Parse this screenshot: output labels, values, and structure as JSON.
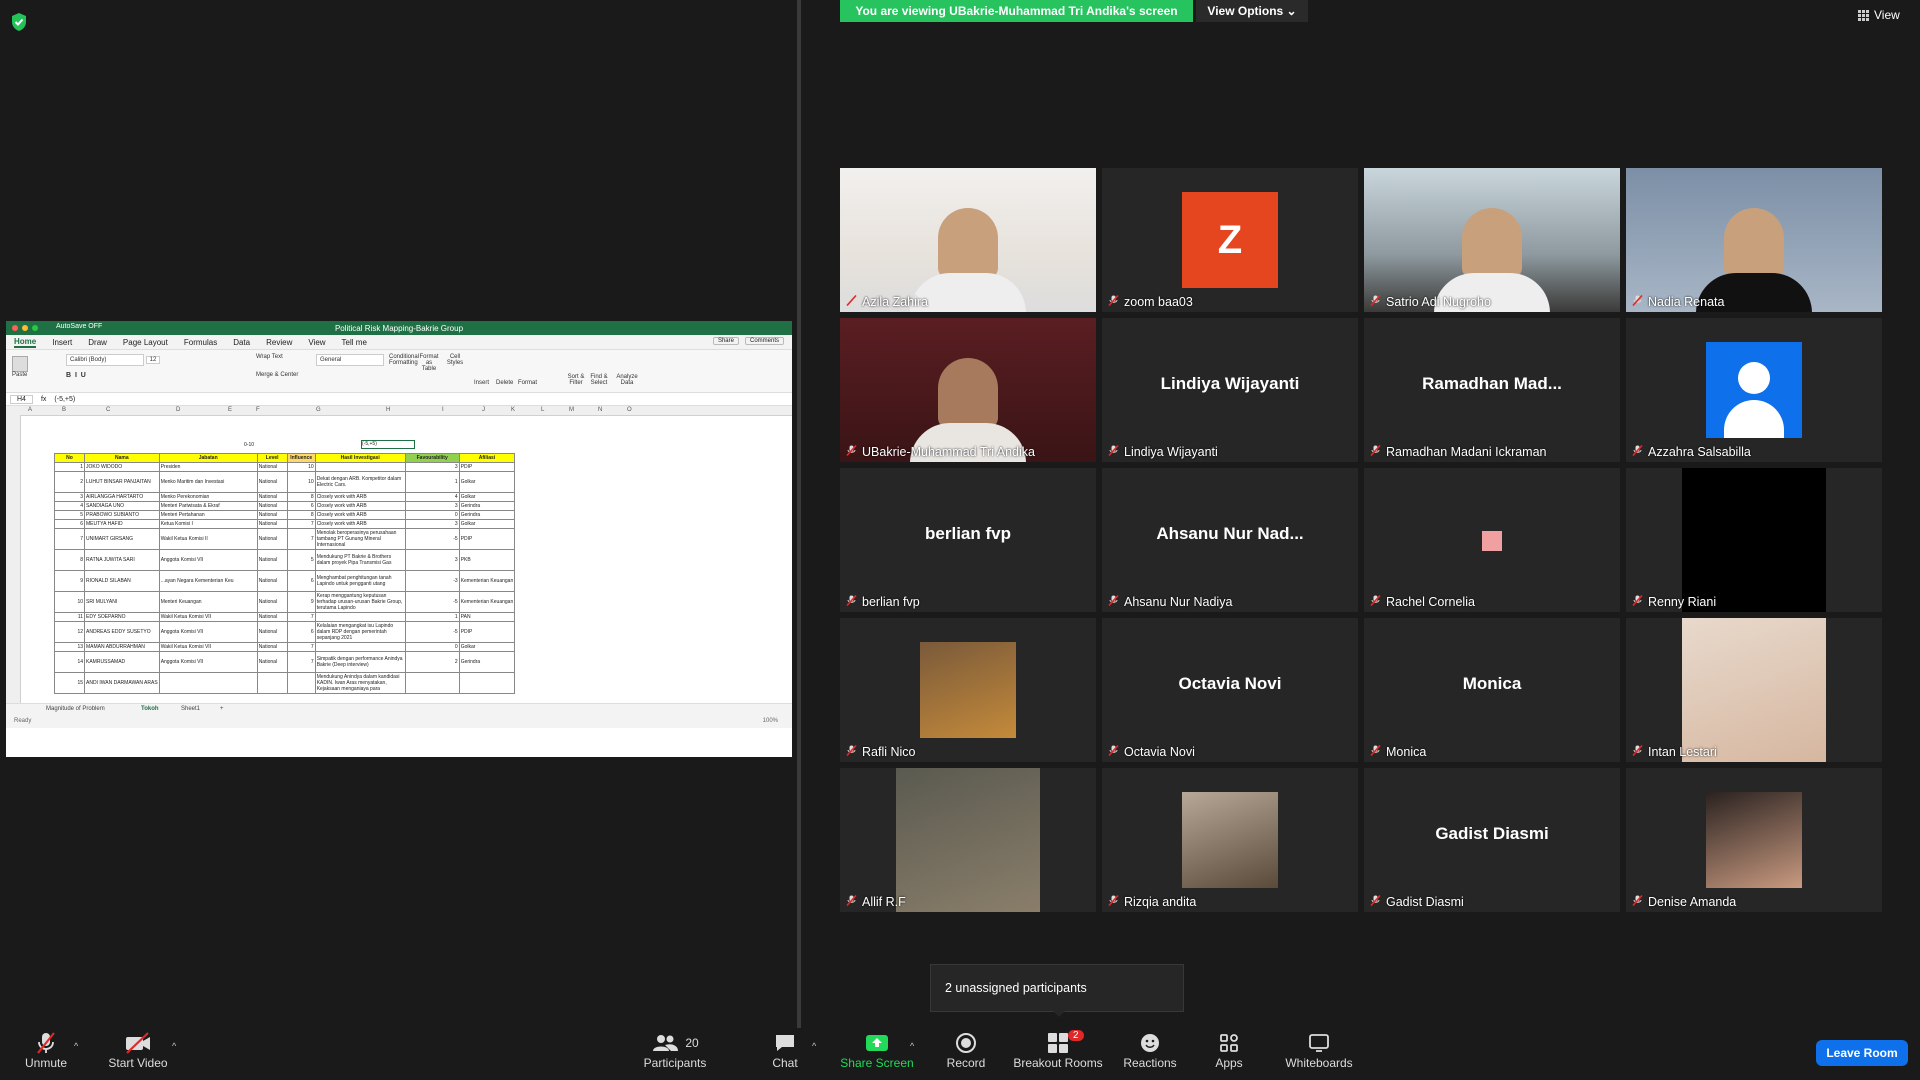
{
  "banner": {
    "text": "You are viewing UBakrie-Muhammad Tri Andika's screen",
    "view_options": "View Options"
  },
  "view_button": "View",
  "excel": {
    "autosave": "AutoSave  OFF",
    "title": "Political Risk Mapping-Bakrie Group",
    "tabs": [
      "Home",
      "Insert",
      "Draw",
      "Page Layout",
      "Formulas",
      "Data",
      "Review",
      "View",
      "Tell me"
    ],
    "share": "Share",
    "comments": "Comments",
    "ribbon": {
      "paste": "Paste",
      "font": "Calibri (Body)",
      "size": "12",
      "wrap": "Wrap Text",
      "merge": "Merge & Center",
      "format": "General",
      "cond": "Conditional Formatting",
      "fmt_table": "Format as Table",
      "cell_styles": "Cell Styles",
      "insert": "Insert",
      "delete": "Delete",
      "format_btn": "Format",
      "sort": "Sort & Filter",
      "find": "Find & Select",
      "analyze": "Analyze Data"
    },
    "cell_ref": "H4",
    "formula": "(-5,+5)",
    "columns": [
      "A",
      "B",
      "C",
      "D",
      "E",
      "F",
      "G",
      "H",
      "I",
      "J",
      "K",
      "L",
      "M",
      "N",
      "O"
    ],
    "scale_f": "0-10",
    "scale_h": "(-5,+5)",
    "headers": [
      "No",
      "Nama",
      "Jabatan",
      "Level",
      "Influence",
      "Hasil Investigasi",
      "Favourability",
      "Afiliasi"
    ],
    "rows": [
      [
        "1",
        "JOKO WIDODO",
        "Presiden",
        "National",
        "10",
        "",
        "3",
        "PDIP"
      ],
      [
        "2",
        "LUHUT BINSAR PANJAITAN",
        "Menko Maritim dan Investasi",
        "National",
        "10",
        "Dekat dengan ARB. Kompetitor dalam Electric Cars.",
        "1",
        "Golkar"
      ],
      [
        "3",
        "AIRLANGGA HARTARTO",
        "Menko Perekonomian",
        "National",
        "8",
        "Closely work with ARB",
        "4",
        "Golkar"
      ],
      [
        "4",
        "SANDIAGA UNO",
        "Menteri Pariwisata & Ekraf",
        "National",
        "6",
        "Closely work with ARB",
        "3",
        "Gerindra"
      ],
      [
        "5",
        "PRABOWO SUBIANTO",
        "Menteri Pertahanan",
        "National",
        "8",
        "Closely work with ARB",
        "0",
        "Gerindra"
      ],
      [
        "6",
        "MEUTYA HAFID",
        "Ketua Komisi I",
        "National",
        "7",
        "Closely work with ARB",
        "3",
        "Golkar"
      ],
      [
        "7",
        "UNIMART GIRSANG",
        "Wakil Ketua Komisi II",
        "National",
        "7",
        "Menolak beroperasinya perusahaan tambang PT Gunung Mineral Internasional",
        "-5",
        "PDIP"
      ],
      [
        "8",
        "RATNA JUWITA SARI",
        "Anggota Komisi VII",
        "National",
        "5",
        "Mendukung PT Bakrie & Brothers dalam proyek Pipa Transmisi Gas",
        "3",
        "PKB"
      ],
      [
        "9",
        "RIONALD SILABAN",
        "...ayan Negara Kementerian Keu",
        "National",
        "6",
        "Menghambat penghitungan tanah Lapindo untuk pengganti utang",
        "-3",
        "Kementerian Keuangan"
      ],
      [
        "10",
        "SRI MULYANI",
        "Menteri Keuangan",
        "National",
        "9",
        "Kerap menggantung keputusan terhadap urusan-urusan Bakrie Group, terutama Lapindo",
        "-5",
        "Kementerian Keuangan"
      ],
      [
        "11",
        "EDY SOEPARNO",
        "Wakil Ketua Komisi VII",
        "National",
        "7",
        "",
        "1",
        "PAN"
      ],
      [
        "12",
        "ANDREAS EDDY SUSETYO",
        "Anggota Komisi VII",
        "National",
        "6",
        "Kelalaian mengangkat isu Lapindo dalam RDP dengan pemerintah sepanjang 2021",
        "-5",
        "PDIP"
      ],
      [
        "13",
        "MAMAN ABDURRAHMAN",
        "Wakil Ketua Komisi VII",
        "National",
        "7",
        "",
        "0",
        "Golkar"
      ],
      [
        "14",
        "KAMRUSSAMAD",
        "Anggota Komisi VII",
        "National",
        "7",
        "Simpatik dengan performance Anindya Bakrie (Deep interview)",
        "2",
        "Gerindra"
      ],
      [
        "15",
        "ANDI IWAN DARMAWAN ARAS",
        "",
        "",
        "",
        "Mendukung Anindya dalam kandidasi KADIN. Iwan Aras menyatakan, Kejaksaan menganiaya para",
        "",
        ""
      ]
    ],
    "sheets": [
      "Magnitude of Problem",
      "Tokoh",
      "Sheet1"
    ],
    "status": "Ready",
    "zoom": "100%"
  },
  "participants": [
    {
      "name": "Azila Zahira",
      "type": "video"
    },
    {
      "name": "zoom baa03",
      "type": "avatar",
      "letter": "Z"
    },
    {
      "name": "Satrio Adi Nugroho",
      "type": "video"
    },
    {
      "name": "Nadia Renata",
      "type": "video"
    },
    {
      "name": "UBakrie-Muhammad Tri Andika",
      "type": "video"
    },
    {
      "name": "Lindiya Wijayanti",
      "type": "name",
      "display": "Lindiya Wijayanti"
    },
    {
      "name": "Ramadhan Madani Ickraman",
      "type": "name",
      "display": "Ramadhan  Mad..."
    },
    {
      "name": "Azzahra Salsabilla",
      "type": "silhouette"
    },
    {
      "name": "berlian fvp",
      "type": "name",
      "display": "berlian fvp"
    },
    {
      "name": "Ahsanu Nur Nadiya",
      "type": "name",
      "display": "Ahsanu  Nur  Nad..."
    },
    {
      "name": "Rachel Cornelia",
      "type": "square"
    },
    {
      "name": "Renny Riani",
      "type": "black"
    },
    {
      "name": "Rafli Nico",
      "type": "photo"
    },
    {
      "name": "Octavia Novi",
      "type": "name",
      "display": "Octavia Novi"
    },
    {
      "name": "Monica",
      "type": "name",
      "display": "Monica"
    },
    {
      "name": "Intan Lestari",
      "type": "photo"
    },
    {
      "name": "Allif R.F",
      "type": "photo"
    },
    {
      "name": "Rizqia andita",
      "type": "photo"
    },
    {
      "name": "Gadist Diasmi",
      "type": "name",
      "display": "Gadist Diasmi"
    },
    {
      "name": "Denise Amanda",
      "type": "photo"
    }
  ],
  "unassigned": "2 unassigned participants",
  "toolbar": {
    "unmute": "Unmute",
    "start_video": "Start Video",
    "participants": "Participants",
    "participant_count": "20",
    "chat": "Chat",
    "share_screen": "Share Screen",
    "record": "Record",
    "breakout": "Breakout Rooms",
    "breakout_badge": "2",
    "reactions": "Reactions",
    "apps": "Apps",
    "whiteboards": "Whiteboards",
    "leave": "Leave Room"
  },
  "colors": {
    "accent_green": "#26c35f",
    "leave_blue": "#0e71eb",
    "active_speaker": "#f5f500",
    "avatar_orange": "#e5461f"
  }
}
